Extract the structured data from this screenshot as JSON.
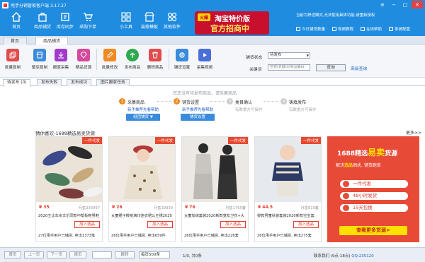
{
  "window": {
    "title": "甩手分销管家客户端 3.17.27"
  },
  "nav": [
    {
      "label": "首页",
      "icon": "home-icon"
    },
    {
      "label": "商品铺货",
      "icon": "goods-icon"
    },
    {
      "label": "库存同步",
      "icon": "sync-icon"
    },
    {
      "label": "采购下单",
      "icon": "cart-icon"
    },
    {
      "label": "小工具",
      "icon": "tools-icon"
    },
    {
      "label": "装修模板",
      "icon": "shop-icon"
    },
    {
      "label": "其他软件",
      "icon": "apps-icon"
    }
  ],
  "promo": {
    "badge": "火爆",
    "line1": "淘宝特价版",
    "line2": "官方招商中"
  },
  "notice": "当前为舒适模式,无法使用具体功能,请重新授权",
  "tools": [
    "今日铺货数量",
    "视频教程",
    "在线帮助",
    "系统配置"
  ],
  "page_tabs": [
    "首页",
    "商品铺货"
  ],
  "toolbar": [
    {
      "label": "批量复制",
      "color": "#e04b4b"
    },
    {
      "label": "整店复制",
      "color": "#3b8bdb"
    },
    {
      "label": "搬家采集",
      "color": "#a23bc9"
    },
    {
      "label": "精品货源",
      "color": "#d44a9c"
    },
    {
      "label": "批量修改",
      "color": "#f08a24"
    },
    {
      "label": "发布商品",
      "color": "#2fa84f"
    },
    {
      "label": "删除商品",
      "color": "#e04b4b"
    },
    {
      "label": "铺货设置",
      "color": "#3b8bdb"
    },
    {
      "label": "采集视频",
      "color": "#4a6fd8"
    }
  ],
  "filter": {
    "status_label": "铺货状态",
    "status_value": "待发布",
    "keyword_label": "关键词",
    "keyword_placeholder": "名称/关键词/商品编码",
    "query": "查询",
    "advanced": "高级查询"
  },
  "sub_tabs": [
    "待发布 (0)",
    "发布失败",
    "发布成功",
    "图片搬家任务"
  ],
  "empty_hint": "您还没有待发布商品，请采集商品",
  "steps": [
    {
      "num": "1",
      "title": "采集商品",
      "sub": "新手推荐先看帮助",
      "button": "组团铺货 ▼"
    },
    {
      "num": "2",
      "title": "铺货设置",
      "sub": "新手推荐先看帮助",
      "button": "铺货设置"
    },
    {
      "num": "3",
      "title": "类目确认",
      "sub": "有数据方可操作",
      "button": ""
    },
    {
      "num": "4",
      "title": "铸填发布",
      "sub": "有数据方可操作",
      "button": ""
    }
  ],
  "recommend": {
    "heading": "猜你喜欢-1688精选易卖货源",
    "more": "更多>>"
  },
  "products": [
    {
      "tag": "一件代发",
      "price": "¥ 35",
      "sold": "月售330097",
      "name": "2020王比车余文乐同款中帮板鞋男鞋",
      "button": "加入选品",
      "stat": "27位甩手用户已铺货, 卖出1373笔"
    },
    {
      "tag": "一件代发",
      "price": "¥ 26",
      "sold": "月售39939",
      "name": "女童裙子樱桃满印连衣裙公主裙2020",
      "button": "加入选品",
      "stat": "26位甩手用户已铺货, 卖出659件"
    },
    {
      "tag": "一件代发",
      "price": "¥ 76",
      "sold": "月售1765套",
      "name": "女童加绒套装2020新款宽松卫衣+大",
      "button": "加入选品",
      "stat": "26位甩手用户已铺货, 卖出226套"
    },
    {
      "tag": "一件代发",
      "price": "¥ 44.5",
      "sold": "月售619套",
      "name": "婴款男童秋装套装2020新款宝宝套",
      "button": "加入选品",
      "stat": "26位甩手用户已铺货, 卖出275套"
    }
  ],
  "ad": {
    "title_pre": "1688精选",
    "title_hot": "易卖",
    "title_post": "货源",
    "sub_pre": "解决",
    "sub_hot": "选品",
    "sub_post": "困扰, 铺货跑单",
    "pills": [
      "一件代发",
      "48小时发货",
      "15天包换"
    ],
    "cta": "查看更多货源>"
  },
  "pager": {
    "first": "首页",
    "prev": "上一页",
    "next": "下一页",
    "last": "尾页",
    "jump": "跳转",
    "per_page": "每页500条",
    "info": "1/0, 共0条",
    "contact_label": "联系我们 (9点-18点)",
    "contact_value": "QQ:235120"
  }
}
